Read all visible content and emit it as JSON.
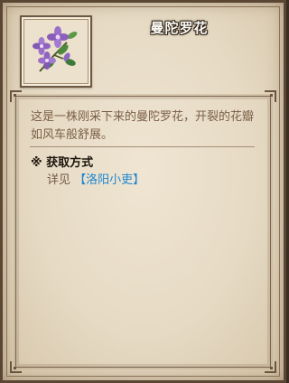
{
  "item": {
    "name": "曼陀罗花",
    "icon": "mandala-flower-icon",
    "description": "这是一株刚采下来的曼陀罗花，开裂的花瓣如风车般舒展。"
  },
  "acquisition": {
    "heading": "※ 获取方式",
    "prefix": "详见",
    "link_label": "【洛阳小吏】"
  },
  "colors": {
    "parchment": "#e6dac4",
    "frame": "#5a4632",
    "description_text": "#7a5f47",
    "link": "#1a86d3",
    "title_text": "#fdfbf6"
  }
}
